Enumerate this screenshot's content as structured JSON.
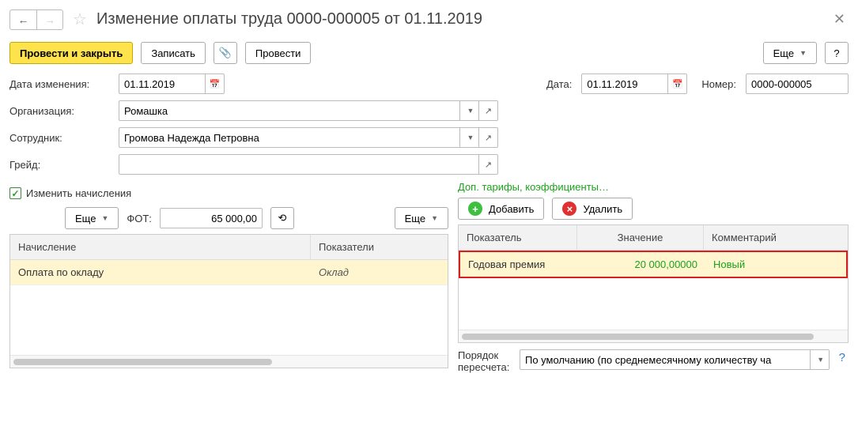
{
  "title": "Изменение оплаты труда 0000-000005 от 01.11.2019",
  "toolbar": {
    "post_close": "Провести и закрыть",
    "save": "Записать",
    "post": "Провести",
    "more": "Еще",
    "help": "?"
  },
  "fields": {
    "change_date_label": "Дата изменения:",
    "change_date": "01.11.2019",
    "date_label": "Дата:",
    "date": "01.11.2019",
    "number_label": "Номер:",
    "number": "0000-000005",
    "org_label": "Организация:",
    "org": "Ромашка",
    "employee_label": "Сотрудник:",
    "employee": "Громова Надежда Петровна",
    "grade_label": "Грейд:",
    "grade": ""
  },
  "checkbox": {
    "label": "Изменить начисления"
  },
  "left": {
    "more": "Еще",
    "fot_label": "ФОТ:",
    "fot_value": "65 000,00",
    "more2": "Еще",
    "col_accrual": "Начисление",
    "col_indicators": "Показатели",
    "row1_accrual": "Оплата по окладу",
    "row1_indicator": "Оклад"
  },
  "right": {
    "link": "Доп. тарифы, коэффициенты…",
    "add": "Добавить",
    "delete": "Удалить",
    "col_indicator": "Показатель",
    "col_value": "Значение",
    "col_comment": "Комментарий",
    "row1_indicator": "Годовая премия",
    "row1_value": "20 000,00000",
    "row1_comment": "Новый",
    "recalc_label": "Порядок пересчета:",
    "recalc_value": "По умолчанию (по среднемесячному количеству ча"
  }
}
